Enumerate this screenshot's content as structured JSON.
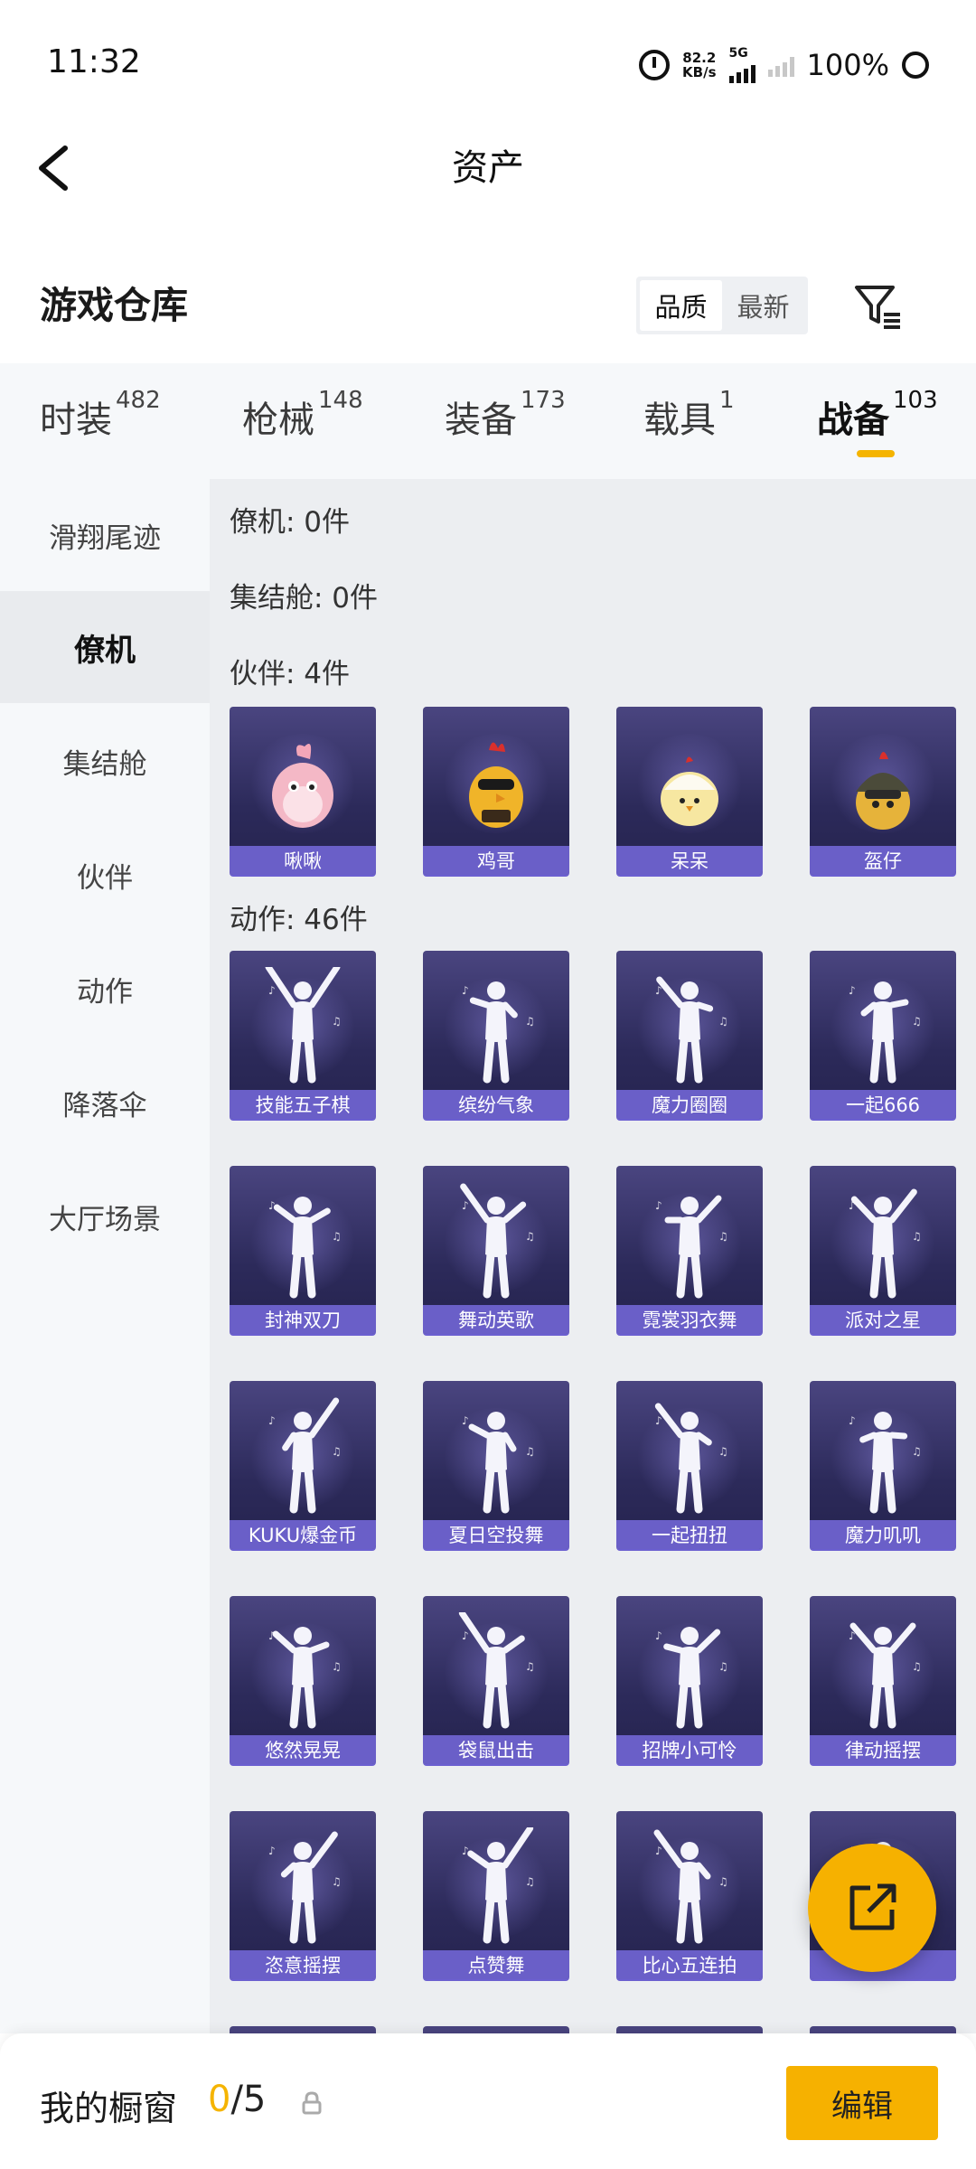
{
  "status": {
    "time": "11:32",
    "net_speed_value": "82.2",
    "net_speed_unit": "KB/s",
    "network": "5G",
    "battery": "100%"
  },
  "header": {
    "title": "资产"
  },
  "warehouse": {
    "title": "游戏仓库",
    "sort_options": [
      "品质",
      "最新"
    ],
    "active_sort": "品质"
  },
  "tabs": [
    {
      "label": "时装",
      "count": "482"
    },
    {
      "label": "枪械",
      "count": "148"
    },
    {
      "label": "装备",
      "count": "173"
    },
    {
      "label": "载具",
      "count": "1"
    },
    {
      "label": "战备",
      "count": "103"
    }
  ],
  "active_tab": "战备",
  "sidebar": {
    "items": [
      "滑翔尾迹",
      "僚机",
      "集结舱",
      "伙伴",
      "动作",
      "降落伞",
      "大厅场景"
    ],
    "active": "僚机"
  },
  "sections": {
    "wingman": "僚机: 0件",
    "capsule": "集结舱: 0件",
    "companion": "伙伴: 4件",
    "emote": "动作: 46件"
  },
  "companions": [
    "啾啾",
    "鸡哥",
    "呆呆",
    "盔仔"
  ],
  "emotes": [
    "技能五子棋",
    "缤纷气象",
    "魔力圈圈",
    "一起666",
    "封神双刀",
    "舞动英歌",
    "霓裳羽衣舞",
    "派对之星",
    "KUKU爆金币",
    "夏日空投舞",
    "一起扭扭",
    "魔力叽叽",
    "悠然晃晃",
    "袋鼠出击",
    "招牌小可怜",
    "律动摇摆",
    "恣意摇摆",
    "点赞舞",
    "比心五连拍",
    ""
  ],
  "bottom": {
    "showcase_label": "我的橱窗",
    "showcase_current": "0",
    "showcase_total": "/5",
    "edit_label": "编辑"
  },
  "colors": {
    "accent": "#f6b100",
    "card_bg": "#2c2a5a",
    "card_label": "#6a5fc8"
  }
}
